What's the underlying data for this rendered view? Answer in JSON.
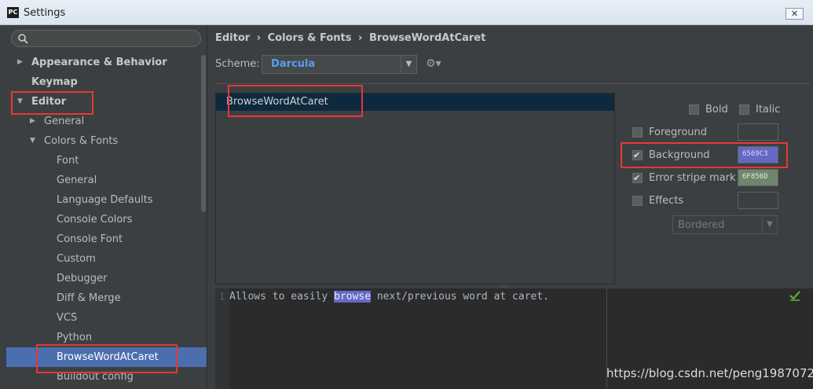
{
  "window": {
    "app_icon": "PC",
    "title": "Settings",
    "close_symbol": "✕"
  },
  "tree": {
    "items": [
      {
        "label": "Appearance & Behavior",
        "arrow": "▶",
        "level": 0,
        "bold": true
      },
      {
        "label": "Keymap",
        "arrow": "",
        "level": 0,
        "bold": true
      },
      {
        "label": "Editor",
        "arrow": "▼",
        "level": 0,
        "bold": true
      },
      {
        "label": "General",
        "arrow": "▶",
        "level": 1,
        "bold": false
      },
      {
        "label": "Colors & Fonts",
        "arrow": "▼",
        "level": 1,
        "bold": false
      },
      {
        "label": "Font",
        "arrow": "",
        "level": 2,
        "bold": false
      },
      {
        "label": "General",
        "arrow": "",
        "level": 2,
        "bold": false
      },
      {
        "label": "Language Defaults",
        "arrow": "",
        "level": 2,
        "bold": false
      },
      {
        "label": "Console Colors",
        "arrow": "",
        "level": 2,
        "bold": false
      },
      {
        "label": "Console Font",
        "arrow": "",
        "level": 2,
        "bold": false
      },
      {
        "label": "Custom",
        "arrow": "",
        "level": 2,
        "bold": false
      },
      {
        "label": "Debugger",
        "arrow": "",
        "level": 2,
        "bold": false
      },
      {
        "label": "Diff & Merge",
        "arrow": "",
        "level": 2,
        "bold": false
      },
      {
        "label": "VCS",
        "arrow": "",
        "level": 2,
        "bold": false
      },
      {
        "label": "Python",
        "arrow": "",
        "level": 2,
        "bold": false
      },
      {
        "label": "BrowseWordAtCaret",
        "arrow": "",
        "level": 2,
        "bold": false,
        "selected": true
      },
      {
        "label": "Buildout config",
        "arrow": "",
        "level": 2,
        "bold": false
      }
    ]
  },
  "breadcrumb": {
    "part1": "Editor",
    "sep1": "›",
    "part2": "Colors & Fonts",
    "sep2": "›",
    "part3": "BrowseWordAtCaret"
  },
  "scheme": {
    "label": "Scheme:",
    "value": "Darcula",
    "dropdown_symbol": "▼",
    "settings_icon": "⚙▾"
  },
  "element_list": {
    "items": [
      "BrowseWordAtCaret"
    ]
  },
  "attributes": {
    "bold": {
      "label": "Bold",
      "checked": false
    },
    "italic": {
      "label": "Italic",
      "checked": false
    },
    "foreground": {
      "label": "Foreground",
      "checked": false,
      "color": ""
    },
    "background": {
      "label": "Background",
      "checked": true,
      "color": "6569C3",
      "hex": "#6569c3"
    },
    "error_stripe": {
      "label": "Error stripe mark",
      "checked": true,
      "color": "6F856D",
      "hex": "#6f856d"
    },
    "effects": {
      "label": "Effects",
      "checked": false,
      "color": ""
    },
    "effect_type": {
      "value": "Bordered",
      "dropdown_symbol": "▼"
    }
  },
  "preview": {
    "line_number": "1",
    "before": "Allows to easily ",
    "highlight": "browse",
    "after": " next/previous word at caret.",
    "splitter": "::::"
  },
  "watermark": "https://blog.csdn.net/peng19870724",
  "colors": {
    "selection": "#4b6eaf",
    "accent": "#589df6",
    "annotation_box": "#e53935"
  }
}
